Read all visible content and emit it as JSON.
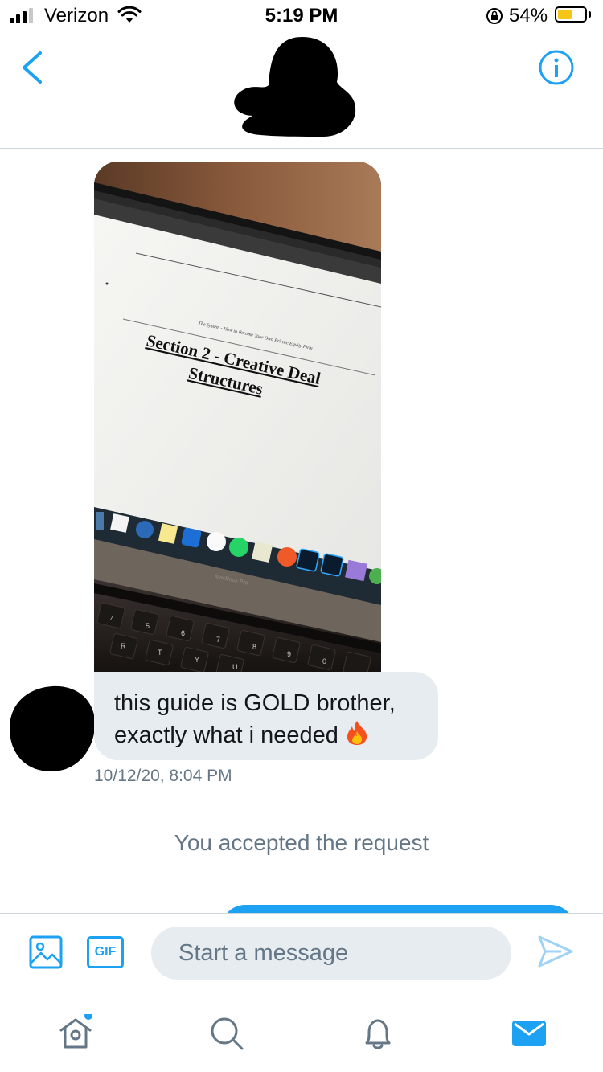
{
  "status_bar": {
    "carrier": "Verizon",
    "time": "5:19 PM",
    "battery_percent": "54%",
    "battery_level": 0.54,
    "signal_bars": 3
  },
  "header": {
    "back_icon": "chevron-left-icon",
    "info_icon": "info-icon"
  },
  "shared_image": {
    "description_icon": "photo-laptop",
    "doc_header": "The System - How to Become Your Own Private Equity Firm",
    "doc_title_line1": "Section 2 - Creative Deal",
    "doc_title_line2": "Structures",
    "laptop_label": "MacBook Pro"
  },
  "message": {
    "line1": "this guide is GOLD brother,",
    "line2": "exactly what i needed",
    "emoji_icon": "fire-icon",
    "timestamp": "10/12/20, 8:04 PM"
  },
  "system_message": "You accepted the request",
  "composer": {
    "placeholder": "Start a message",
    "gif_label": "GIF"
  },
  "tab_bar": {
    "items": [
      "home",
      "search",
      "notifications",
      "messages"
    ],
    "active": "messages",
    "home_has_dot": true
  },
  "colors": {
    "accent": "#1da1f2",
    "bubble": "#e6ecf0",
    "muted_text": "#657786",
    "battery": "#f5c518"
  }
}
